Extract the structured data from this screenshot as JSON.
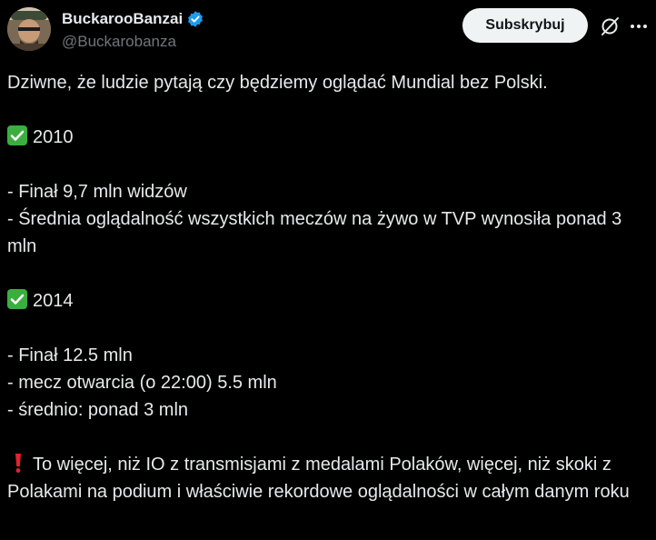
{
  "author": {
    "display_name": "BuckarooBanzai",
    "handle": "@Buckarobanza",
    "avatar_icon": "avatar-photo",
    "verified_icon": "verified-badge-icon"
  },
  "actions": {
    "subscribe_label": "Subskrybuj",
    "grok_icon": "grok-icon",
    "more_icon": "more-icon"
  },
  "post": {
    "intro": "Dziwne, że ludzie pytają czy będziemy oglądać Mundial bez Polski.",
    "section_2010": {
      "year": "2010",
      "lines": [
        "- Finał 9,7 mln widzów",
        "- Średnia oglądalność wszystkich meczów na żywo w TVP wynosiła ponad 3 mln"
      ]
    },
    "section_2014": {
      "year": "2014",
      "lines": [
        "- Finał 12.5 mln",
        "- mecz otwarcia (o 22:00) 5.5 mln",
        "- średnio: ponad 3 mln"
      ]
    },
    "conclusion": "To więcej, niż IO z transmisjami z medalami Polaków, więcej, niż skoki z Polakami na podium i właściwie rekordowe oglądalności w całym danym roku"
  },
  "colors": {
    "background": "#000000",
    "text": "#e7e9ea",
    "secondary": "#71767b",
    "verified": "#1d9bf0",
    "check": "#3cae3f",
    "exclamation": "#e0242c"
  }
}
